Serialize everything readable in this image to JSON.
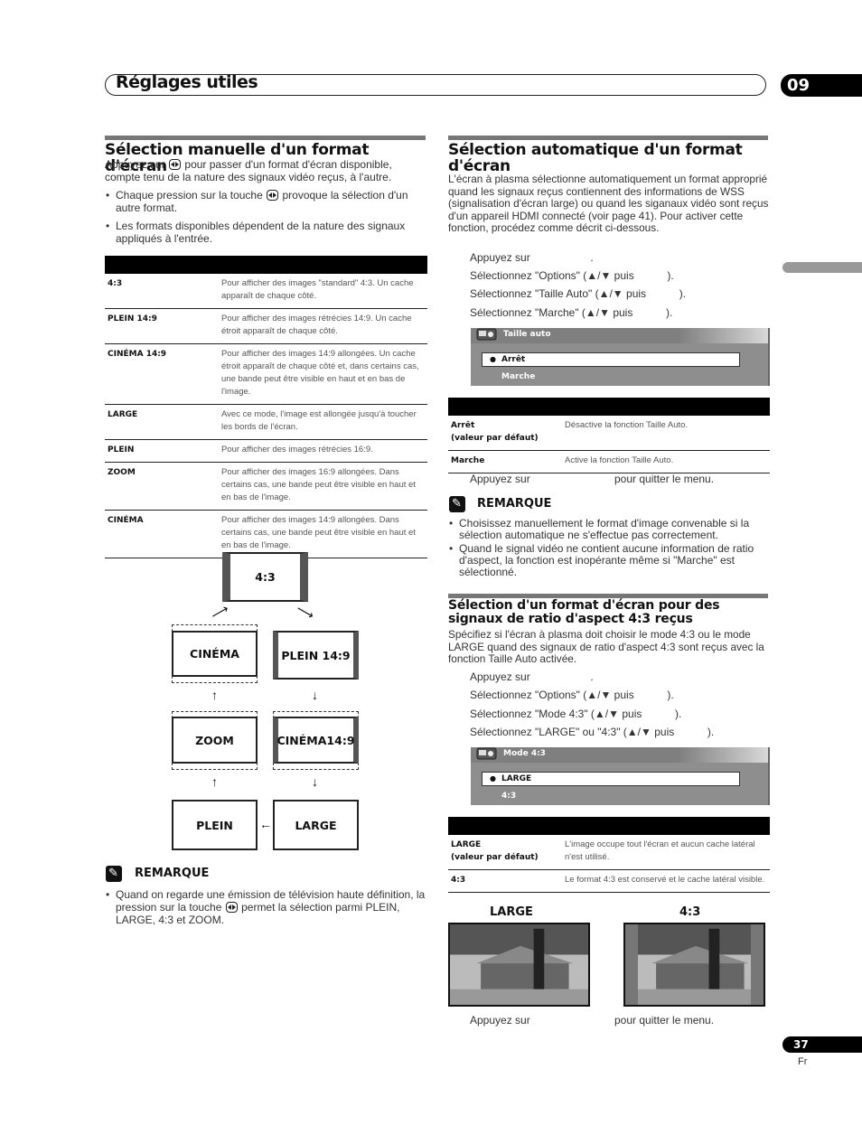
{
  "header": {
    "title": "Réglages utiles",
    "chapter": "09"
  },
  "footer": {
    "page_number": "37",
    "language": "Fr"
  },
  "left": {
    "title": "Sélection manuelle d'un format d'écran",
    "intro_a": "Appuyez sur",
    "intro_b": "pour passer d'un format d'écran disponible, compte tenu de la nature des signaux vidéo reçus, à l'autre.",
    "bullets": [
      {
        "a": "Chaque pression sur la touche",
        "b": "provoque la sélection d'un autre format."
      },
      {
        "a": "Les formats disponibles dépendent de la nature des signaux appliqués à l'entrée.",
        "b": ""
      }
    ],
    "table": [
      {
        "key": "4:3",
        "value": "Pour afficher des images \"standard\" 4:3. Un cache apparaît de chaque côté."
      },
      {
        "key": "PLEIN 14:9",
        "value": "Pour afficher des images rétrécies 14:9. Un cache étroit apparaît de chaque côté."
      },
      {
        "key": "CINÉMA 14:9",
        "value": "Pour afficher des images 14:9 allongées. Un cache étroit apparaît de chaque côté et, dans certains cas, une bande peut être visible en haut et en bas de l'image."
      },
      {
        "key": "LARGE",
        "value": "Avec ce mode, l'image est allongée jusqu'à toucher les bords de l'écran."
      },
      {
        "key": "PLEIN",
        "value": "Pour afficher des images rétrécies 16:9."
      },
      {
        "key": "ZOOM",
        "value": "Pour afficher des images 16:9 allongées. Dans certains cas, une bande peut être visible en haut et en bas de l'image."
      },
      {
        "key": "CINÉMA",
        "value": "Pour afficher des images 14:9 allongées. Dans certains cas, une bande peut être visible en haut et en bas de l'image."
      }
    ],
    "diagram": {
      "n43": "4:3",
      "cinema": "CINÉMA",
      "plein149": "PLEIN 14:9",
      "zoom": "ZOOM",
      "cinema149": "CINÉMA14:9",
      "plein": "PLEIN",
      "large": "LARGE"
    },
    "remark": {
      "title": "REMARQUE",
      "a": "Quand on regarde une émission de télévision haute définition, la pression sur la touche",
      "b": "permet la sélection parmi PLEIN, LARGE, 4:3 et ZOOM."
    }
  },
  "right": {
    "auto": {
      "title": "Sélection automatique d'un format d'écran",
      "intro": "L'écran à plasma sélectionne automatiquement un format approprié quand les signaux reçus contiennent des informations de WSS (signalisation d'écran large) ou quand les siganaux vidéo sont reçus d'un appareil HDMI connecté (voir page 41). Pour activer cette fonction, procédez comme décrit ci-dessous.",
      "steps": [
        "Appuyez sur                    .",
        "Sélectionnez \"Options\" (▲/▼ puis           ).",
        "Sélectionnez \"Taille Auto\" (▲/▼ puis           ).",
        "Sélectionnez \"Marche\" (▲/▼ puis           )."
      ],
      "osd": {
        "title": "Taille auto",
        "selected": "Arrêt",
        "other": "Marche"
      },
      "table": [
        {
          "key": "Arrêt\n(valeur par défaut)",
          "value": "Désactive la fonction Taille Auto."
        },
        {
          "key": "Marche",
          "value": "Active la fonction Taille Auto."
        }
      ],
      "exit_a": "Appuyez sur",
      "exit_b": "pour quitter le menu.",
      "remark": {
        "title": "REMARQUE",
        "bullets": [
          "Choisissez manuellement le format d'image convenable si la sélection automatique ne s'effectue pas correctement.",
          "Quand le signal vidéo ne contient aucune information de ratio d'aspect, la fonction est inopérante même si \"Marche\" est sélectionné."
        ]
      }
    },
    "mode43": {
      "title": "Sélection d'un format d'écran pour des signaux de ratio d'aspect 4:3 reçus",
      "intro": "Spécifiez si l'écran à plasma doit choisir le mode 4:3 ou le mode LARGE quand des signaux de ratio d'aspect 4:3 sont reçus avec la fonction Taille Auto activée.",
      "steps": [
        "Appuyez sur                    .",
        "Sélectionnez \"Options\" (▲/▼ puis           ).",
        "Sélectionnez \"Mode 4:3\" (▲/▼ puis           ).",
        "Sélectionnez \"LARGE\" ou \"4:3\" (▲/▼ puis           )."
      ],
      "osd": {
        "title": "Mode 4:3",
        "selected": "LARGE",
        "other": "4:3"
      },
      "table": [
        {
          "key": "LARGE\n(valeur par défaut)",
          "value": "L'image occupe tout l'écran et aucun cache latéral n'est utilisé."
        },
        {
          "key": "4:3",
          "value": "Le format 4:3 est conservé et le cache latéral visible."
        }
      ],
      "photo_labels": {
        "large": "LARGE",
        "n43": "4:3"
      },
      "exit_a": "Appuyez sur",
      "exit_b": "pour quitter le menu."
    }
  }
}
